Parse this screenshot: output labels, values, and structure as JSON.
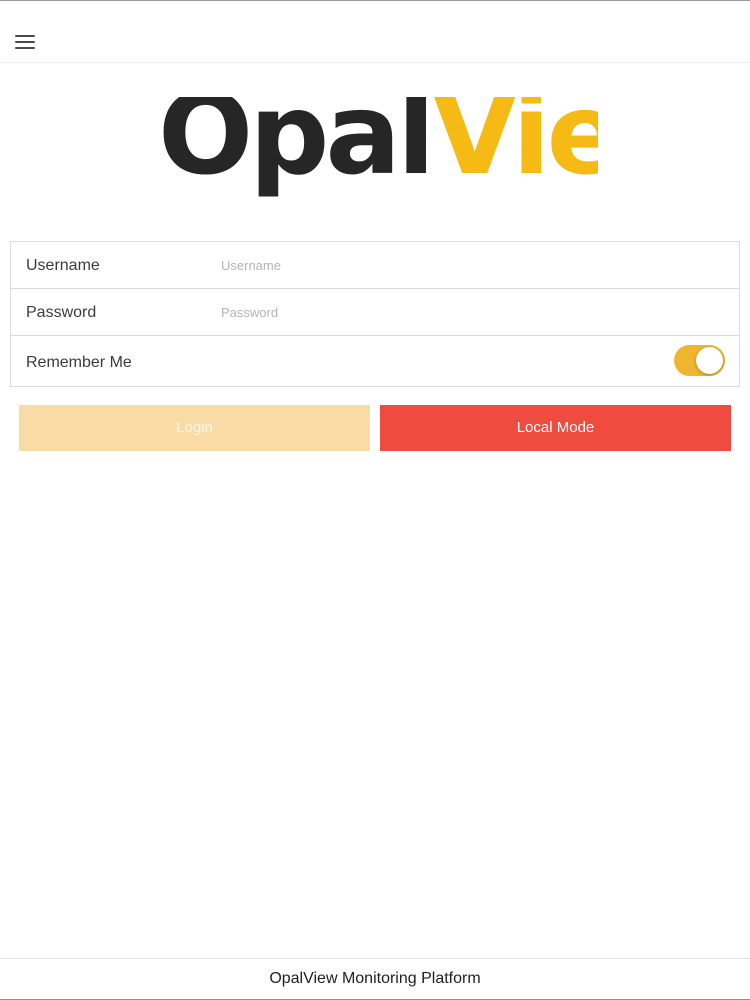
{
  "header": {
    "menu_icon": "hamburger-menu-icon"
  },
  "logo": {
    "part1": "Opal",
    "part2": "View",
    "color_dark": "#262626",
    "color_accent": "#f5bb14"
  },
  "form": {
    "username": {
      "label": "Username",
      "placeholder": "Username",
      "value": ""
    },
    "password": {
      "label": "Password",
      "placeholder": "Password",
      "value": ""
    },
    "remember": {
      "label": "Remember Me",
      "on": true,
      "color": "#f0b52e"
    }
  },
  "buttons": {
    "login": {
      "label": "Login",
      "color": "#f8dba5",
      "disabled": true
    },
    "local_mode": {
      "label": "Local Mode",
      "color": "#ef4b3f"
    }
  },
  "footer": {
    "text": "OpalView Monitoring Platform"
  }
}
